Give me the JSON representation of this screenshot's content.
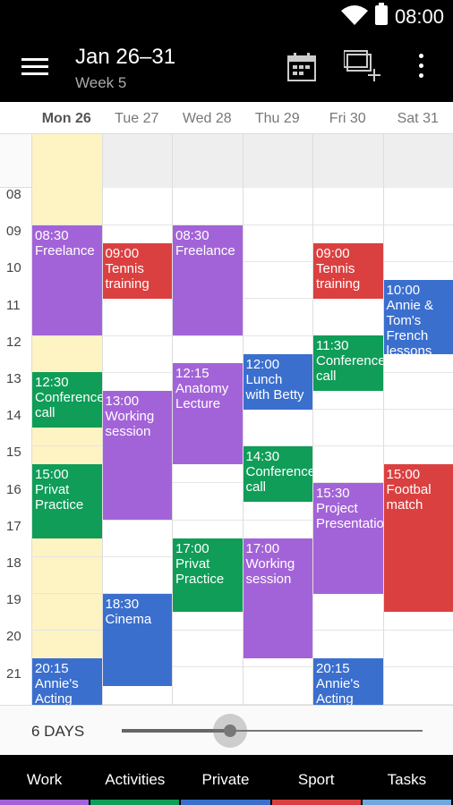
{
  "status": {
    "time": "08:00"
  },
  "appbar": {
    "title": "Jan 26–31",
    "subtitle": "Week 5"
  },
  "days": [
    {
      "label": "Mon 26",
      "today": true
    },
    {
      "label": "Tue 27",
      "today": false
    },
    {
      "label": "Wed 28",
      "today": false
    },
    {
      "label": "Thu 29",
      "today": false
    },
    {
      "label": "Fri 30",
      "today": false
    },
    {
      "label": "Sat 31",
      "today": false
    }
  ],
  "hours": [
    "08",
    "09",
    "10",
    "11",
    "12",
    "13",
    "14",
    "15",
    "16",
    "17",
    "18",
    "19",
    "20",
    "21"
  ],
  "colors": {
    "purple": "#a363d8",
    "red": "#db4040",
    "green": "#0f9d58",
    "blue": "#3b6fce"
  },
  "events": [
    {
      "day": 0,
      "start": 8.5,
      "end": 11.5,
      "color": "#a363d8",
      "time": "08:30",
      "title": "Freelance"
    },
    {
      "day": 0,
      "start": 12.5,
      "end": 14.0,
      "color": "#0f9d58",
      "time": "12:30",
      "title": "Conference call"
    },
    {
      "day": 0,
      "start": 15.0,
      "end": 17.0,
      "color": "#0f9d58",
      "time": "15:00",
      "title": "Privat Practice"
    },
    {
      "day": 0,
      "start": 20.25,
      "end": 21.75,
      "color": "#3b6fce",
      "time": "20:15",
      "title": "Annie's Acting"
    },
    {
      "day": 1,
      "start": 9.0,
      "end": 10.5,
      "color": "#db4040",
      "time": "09:00",
      "title": "Tennis training"
    },
    {
      "day": 1,
      "start": 13.0,
      "end": 16.5,
      "color": "#a363d8",
      "time": "13:00",
      "title": "Working session"
    },
    {
      "day": 1,
      "start": 18.5,
      "end": 21.0,
      "color": "#3b6fce",
      "time": "18:30",
      "title": "Cinema"
    },
    {
      "day": 2,
      "start": 8.5,
      "end": 11.5,
      "color": "#a363d8",
      "time": "08:30",
      "title": "Freelance"
    },
    {
      "day": 2,
      "start": 12.25,
      "end": 15.0,
      "color": "#a363d8",
      "time": "12:15",
      "title": "Anatomy Lecture"
    },
    {
      "day": 2,
      "start": 17.0,
      "end": 19.0,
      "color": "#0f9d58",
      "time": "17:00",
      "title": "Privat Practice"
    },
    {
      "day": 3,
      "start": 12.0,
      "end": 13.5,
      "color": "#3b6fce",
      "time": "12:00",
      "title": "Lunch with Betty"
    },
    {
      "day": 3,
      "start": 14.5,
      "end": 16.0,
      "color": "#0f9d58",
      "time": "14:30",
      "title": "Conference call"
    },
    {
      "day": 3,
      "start": 17.0,
      "end": 20.25,
      "color": "#a363d8",
      "time": "17:00",
      "title": "Working session"
    },
    {
      "day": 4,
      "start": 9.0,
      "end": 10.5,
      "color": "#db4040",
      "time": "09:00",
      "title": "Tennis training"
    },
    {
      "day": 4,
      "start": 11.5,
      "end": 13.0,
      "color": "#0f9d58",
      "time": "11:30",
      "title": "Conference call"
    },
    {
      "day": 4,
      "start": 15.5,
      "end": 18.5,
      "color": "#a363d8",
      "time": "15:30",
      "title": "Project Presentation"
    },
    {
      "day": 4,
      "start": 20.25,
      "end": 21.75,
      "color": "#3b6fce",
      "time": "20:15",
      "title": "Annie's Acting"
    },
    {
      "day": 5,
      "start": 10.0,
      "end": 12.0,
      "color": "#3b6fce",
      "time": "10:00",
      "title": "Annie & Tom's French lessons"
    },
    {
      "day": 5,
      "start": 15.0,
      "end": 19.0,
      "color": "#db4040",
      "time": "15:00",
      "title": "Footbal match"
    }
  ],
  "slider": {
    "label": "6 DAYS",
    "value_fraction": 0.36
  },
  "tabs": [
    {
      "label": "Work",
      "color": "#a363d8"
    },
    {
      "label": "Activities",
      "color": "#0f9d58"
    },
    {
      "label": "Private",
      "color": "#3b6fce"
    },
    {
      "label": "Sport",
      "color": "#db4040"
    },
    {
      "label": "Tasks",
      "color": "#6fa8dc"
    }
  ],
  "icons": [
    "menu-icon",
    "calendar-icon",
    "add-event-icon",
    "more-icon",
    "wifi-icon",
    "battery-icon"
  ]
}
